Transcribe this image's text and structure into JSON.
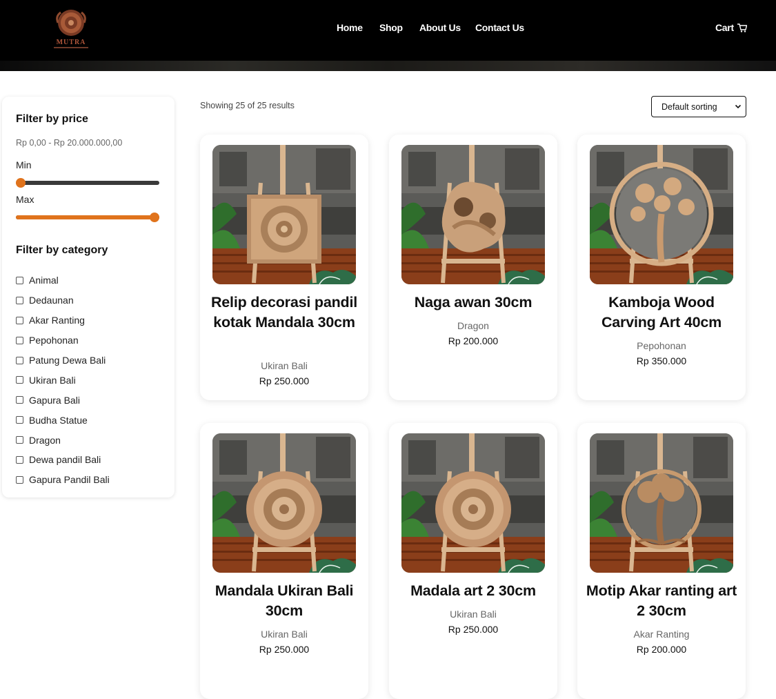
{
  "brand": {
    "name": "MUTRA"
  },
  "nav": {
    "home": "Home",
    "shop": "Shop",
    "about": "About Us",
    "contact": "Contact Us",
    "cart": "Cart"
  },
  "sidebar": {
    "price_heading": "Filter by price",
    "price_range": "Rp 0,00 - Rp 20.000.000,00",
    "min_label": "Min",
    "max_label": "Max",
    "min_value_fraction": 0.0,
    "max_value_fraction": 1.0,
    "category_heading": "Filter by category",
    "categories": [
      "Animal",
      "Dedaunan",
      "Akar Ranting",
      "Pepohonan",
      "Patung Dewa Bali",
      "Ukiran Bali",
      "Gapura Bali",
      "Budha Statue",
      "Dragon",
      "Dewa pandil Bali",
      "Gapura Pandil Bali"
    ]
  },
  "toolbar": {
    "result_count": "Showing 25 of 25 results",
    "sort_selected": "Default sorting"
  },
  "products": [
    {
      "title": "Relip decorasi pandil kotak Mandala 30cm",
      "category": "Ukiran Bali",
      "price": "Rp 250.000",
      "image": "square-mandala-carving"
    },
    {
      "title": "Naga awan 30cm",
      "category": "Dragon",
      "price": "Rp 200.000",
      "image": "dragon-carving"
    },
    {
      "title": "Kamboja Wood Carving Art 40cm",
      "category": "Pepohonan",
      "price": "Rp 350.000",
      "image": "flower-tree-carving"
    },
    {
      "title": "Mandala Ukiran Bali 30cm",
      "category": "Ukiran Bali",
      "price": "Rp 250.000",
      "image": "round-mandala-carving"
    },
    {
      "title": "Madala art 2 30cm",
      "category": "Ukiran Bali",
      "price": "Rp 250.000",
      "image": "round-mandala-carving"
    },
    {
      "title": "Motip Akar ranting art 2 30cm",
      "category": "Akar Ranting",
      "price": "Rp 200.000",
      "image": "tree-of-life-carving"
    }
  ],
  "colors": {
    "accent": "#e0731c",
    "header_bg": "#000000",
    "wood": "#c79a6e"
  }
}
